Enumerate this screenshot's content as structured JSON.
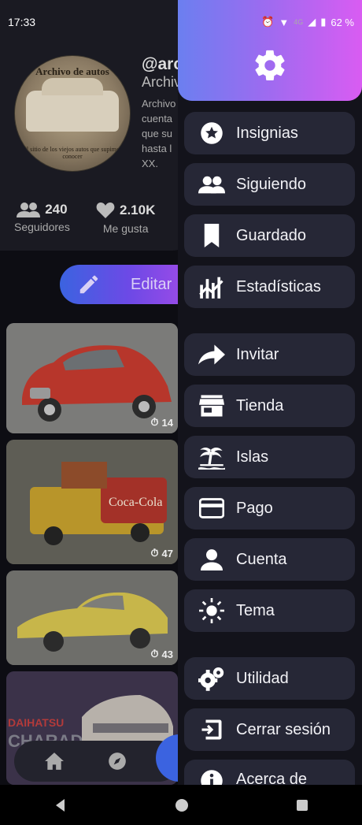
{
  "status_bar": {
    "time": "17:33",
    "network": "4G",
    "battery": "62 %"
  },
  "profile": {
    "handle": "@arc",
    "name": "Archiv",
    "bio": "Archivo cuenta que su hasta l XX.",
    "avatar_title": "Archivo de autos",
    "avatar_subtitle": "El sitio de los viejos autos que supimos conocer",
    "followers": {
      "count": "240",
      "label": "Seguidores"
    },
    "likes": {
      "count": "2.10K",
      "label": "Me gusta"
    },
    "edit_label": "Editar"
  },
  "posts": [
    {
      "count": "14"
    },
    {
      "count": "47"
    },
    {
      "count": "43"
    },
    {
      "count": ""
    }
  ],
  "drawer": {
    "header_icon": "gear-icon",
    "items": [
      {
        "label": "Insignias",
        "icon": "star-badge-icon"
      },
      {
        "label": "Siguiendo",
        "icon": "people-icon"
      },
      {
        "label": "Guardado",
        "icon": "bookmark-icon"
      },
      {
        "label": "Estadísticas",
        "icon": "chart-icon"
      },
      {
        "label": "Invitar",
        "icon": "share-arrow-icon"
      },
      {
        "label": "Tienda",
        "icon": "store-icon"
      },
      {
        "label": "Islas",
        "icon": "island-icon"
      },
      {
        "label": "Pago",
        "icon": "credit-card-icon"
      },
      {
        "label": "Cuenta",
        "icon": "person-icon"
      },
      {
        "label": "Tema",
        "icon": "sun-icon"
      },
      {
        "label": "Utilidad",
        "icon": "gears-icon"
      },
      {
        "label": "Cerrar sesión",
        "icon": "logout-icon"
      },
      {
        "label": "Acerca de",
        "icon": "info-icon"
      }
    ]
  },
  "colors": {
    "accent_blue": "#3b63e0",
    "accent_magenta": "#d95cf2",
    "menu_bg": "#262736"
  }
}
